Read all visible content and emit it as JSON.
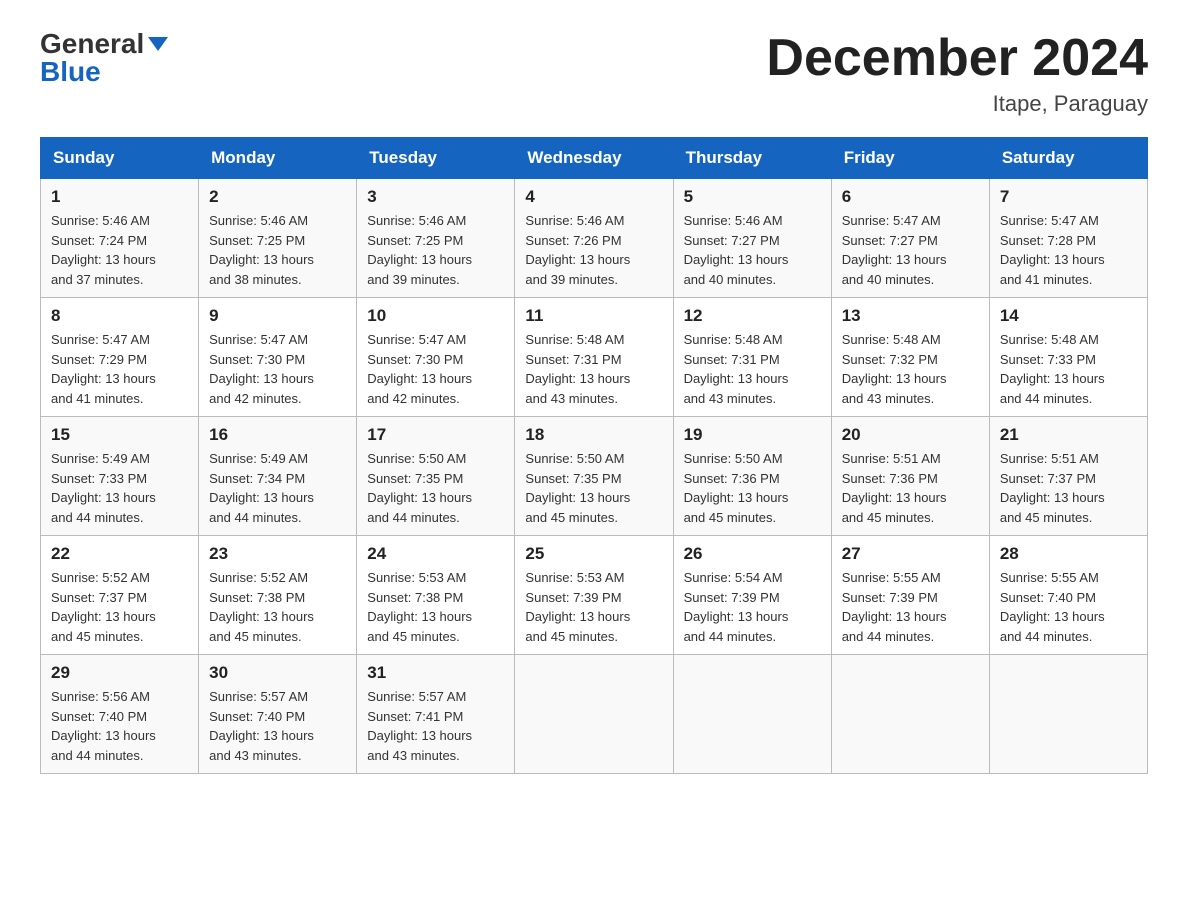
{
  "header": {
    "logo_general": "General",
    "logo_blue": "Blue",
    "title": "December 2024",
    "location": "Itape, Paraguay"
  },
  "weekdays": [
    "Sunday",
    "Monday",
    "Tuesday",
    "Wednesday",
    "Thursday",
    "Friday",
    "Saturday"
  ],
  "weeks": [
    [
      {
        "day": "1",
        "sunrise": "5:46 AM",
        "sunset": "7:24 PM",
        "daylight": "13 hours and 37 minutes."
      },
      {
        "day": "2",
        "sunrise": "5:46 AM",
        "sunset": "7:25 PM",
        "daylight": "13 hours and 38 minutes."
      },
      {
        "day": "3",
        "sunrise": "5:46 AM",
        "sunset": "7:25 PM",
        "daylight": "13 hours and 39 minutes."
      },
      {
        "day": "4",
        "sunrise": "5:46 AM",
        "sunset": "7:26 PM",
        "daylight": "13 hours and 39 minutes."
      },
      {
        "day": "5",
        "sunrise": "5:46 AM",
        "sunset": "7:27 PM",
        "daylight": "13 hours and 40 minutes."
      },
      {
        "day": "6",
        "sunrise": "5:47 AM",
        "sunset": "7:27 PM",
        "daylight": "13 hours and 40 minutes."
      },
      {
        "day": "7",
        "sunrise": "5:47 AM",
        "sunset": "7:28 PM",
        "daylight": "13 hours and 41 minutes."
      }
    ],
    [
      {
        "day": "8",
        "sunrise": "5:47 AM",
        "sunset": "7:29 PM",
        "daylight": "13 hours and 41 minutes."
      },
      {
        "day": "9",
        "sunrise": "5:47 AM",
        "sunset": "7:30 PM",
        "daylight": "13 hours and 42 minutes."
      },
      {
        "day": "10",
        "sunrise": "5:47 AM",
        "sunset": "7:30 PM",
        "daylight": "13 hours and 42 minutes."
      },
      {
        "day": "11",
        "sunrise": "5:48 AM",
        "sunset": "7:31 PM",
        "daylight": "13 hours and 43 minutes."
      },
      {
        "day": "12",
        "sunrise": "5:48 AM",
        "sunset": "7:31 PM",
        "daylight": "13 hours and 43 minutes."
      },
      {
        "day": "13",
        "sunrise": "5:48 AM",
        "sunset": "7:32 PM",
        "daylight": "13 hours and 43 minutes."
      },
      {
        "day": "14",
        "sunrise": "5:48 AM",
        "sunset": "7:33 PM",
        "daylight": "13 hours and 44 minutes."
      }
    ],
    [
      {
        "day": "15",
        "sunrise": "5:49 AM",
        "sunset": "7:33 PM",
        "daylight": "13 hours and 44 minutes."
      },
      {
        "day": "16",
        "sunrise": "5:49 AM",
        "sunset": "7:34 PM",
        "daylight": "13 hours and 44 minutes."
      },
      {
        "day": "17",
        "sunrise": "5:50 AM",
        "sunset": "7:35 PM",
        "daylight": "13 hours and 44 minutes."
      },
      {
        "day": "18",
        "sunrise": "5:50 AM",
        "sunset": "7:35 PM",
        "daylight": "13 hours and 45 minutes."
      },
      {
        "day": "19",
        "sunrise": "5:50 AM",
        "sunset": "7:36 PM",
        "daylight": "13 hours and 45 minutes."
      },
      {
        "day": "20",
        "sunrise": "5:51 AM",
        "sunset": "7:36 PM",
        "daylight": "13 hours and 45 minutes."
      },
      {
        "day": "21",
        "sunrise": "5:51 AM",
        "sunset": "7:37 PM",
        "daylight": "13 hours and 45 minutes."
      }
    ],
    [
      {
        "day": "22",
        "sunrise": "5:52 AM",
        "sunset": "7:37 PM",
        "daylight": "13 hours and 45 minutes."
      },
      {
        "day": "23",
        "sunrise": "5:52 AM",
        "sunset": "7:38 PM",
        "daylight": "13 hours and 45 minutes."
      },
      {
        "day": "24",
        "sunrise": "5:53 AM",
        "sunset": "7:38 PM",
        "daylight": "13 hours and 45 minutes."
      },
      {
        "day": "25",
        "sunrise": "5:53 AM",
        "sunset": "7:39 PM",
        "daylight": "13 hours and 45 minutes."
      },
      {
        "day": "26",
        "sunrise": "5:54 AM",
        "sunset": "7:39 PM",
        "daylight": "13 hours and 44 minutes."
      },
      {
        "day": "27",
        "sunrise": "5:55 AM",
        "sunset": "7:39 PM",
        "daylight": "13 hours and 44 minutes."
      },
      {
        "day": "28",
        "sunrise": "5:55 AM",
        "sunset": "7:40 PM",
        "daylight": "13 hours and 44 minutes."
      }
    ],
    [
      {
        "day": "29",
        "sunrise": "5:56 AM",
        "sunset": "7:40 PM",
        "daylight": "13 hours and 44 minutes."
      },
      {
        "day": "30",
        "sunrise": "5:57 AM",
        "sunset": "7:40 PM",
        "daylight": "13 hours and 43 minutes."
      },
      {
        "day": "31",
        "sunrise": "5:57 AM",
        "sunset": "7:41 PM",
        "daylight": "13 hours and 43 minutes."
      },
      null,
      null,
      null,
      null
    ]
  ],
  "labels": {
    "sunrise_prefix": "Sunrise: ",
    "sunset_prefix": "Sunset: ",
    "daylight_prefix": "Daylight: "
  }
}
